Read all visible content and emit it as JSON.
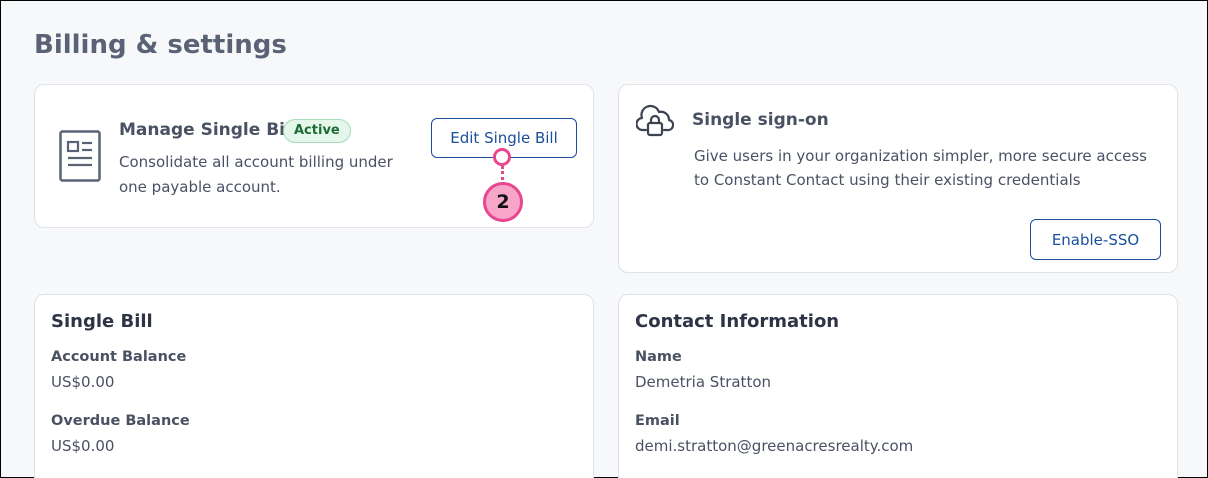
{
  "page": {
    "title": "Billing & settings"
  },
  "manage_single_bill": {
    "title": "Manage Single Bill",
    "badge": "Active",
    "description": "Consolidate all account billing under one payable account.",
    "edit_button": "Edit Single Bill",
    "icon": "document-icon"
  },
  "callout": {
    "number": "2"
  },
  "sso": {
    "title": "Single sign-on",
    "description": "Give users in your organization simpler, more secure access to Constant Contact using their existing credentials",
    "button": "Enable-SSO",
    "icon": "cloud-lock-icon"
  },
  "single_bill": {
    "title": "Single Bill",
    "account_balance_label": "Account Balance",
    "account_balance_value": "US$0.00",
    "overdue_balance_label": "Overdue Balance",
    "overdue_balance_value": "US$0.00"
  },
  "contact": {
    "title": "Contact Information",
    "name_label": "Name",
    "name_value": "Demetria Stratton",
    "email_label": "Email",
    "email_value": "demi.stratton@greenacresrealty.com"
  },
  "colors": {
    "accent": "#1a4f9c",
    "callout": "#e8478f",
    "callout_fill": "#f7a6c9",
    "badge_bg": "#e5f6ea",
    "badge_text": "#1d6b35"
  }
}
